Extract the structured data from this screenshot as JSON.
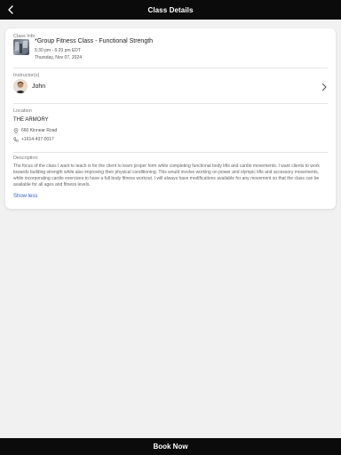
{
  "header": {
    "title": "Class Details"
  },
  "class_info": {
    "label": "Class Info",
    "name": "*Group Fitness Class - Functional Strength",
    "time": "5:30 pm - 6:20 pm EDT",
    "date": "Thursday, Nov 07, 2024"
  },
  "instructor": {
    "label": "Instructor(s)",
    "name": "John"
  },
  "location": {
    "label": "Location",
    "name": "THE ARMORY",
    "address": "660 Kinnear Road",
    "phone": "+1614-437-0017"
  },
  "description": {
    "label": "Description",
    "text": "The focus of the class I want to teach is for the client to learn proper form while completing functional body lifts and cardio movements. I want clients to work towards building strength while also improving their physical conditioning. This would involve working on power and olympic lifts and accessory movements, while incorporating cardio exercises to have a full body fitness workout. I will always have modifications available for any movement so that the class can be available for all ages and fitness levels.",
    "toggle_label": "Show less"
  },
  "footer": {
    "cta_label": "Book Now"
  }
}
